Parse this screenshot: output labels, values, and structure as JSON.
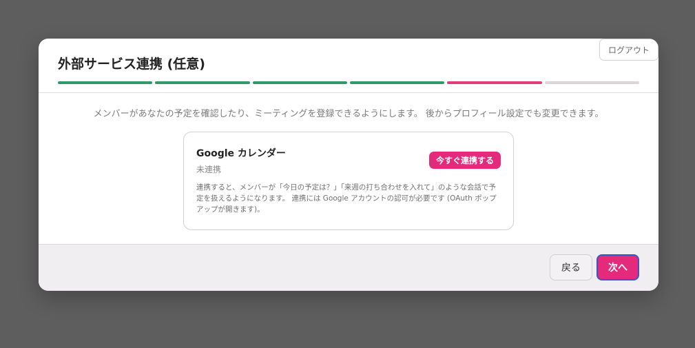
{
  "header": {
    "title": "外部サービス連携 (任意)",
    "logout_label": "ログアウト"
  },
  "progress": {
    "total_steps": 6,
    "current_step": 5,
    "colors": {
      "done": "#2f9a63",
      "current": "#e03b7a",
      "pending": "#ddd4d8"
    }
  },
  "intro": "メンバーがあなたの予定を確認したり、ミーティングを登録できるようにします。 後からプロフィール設定でも変更できます。",
  "integration": {
    "name": "Google カレンダー",
    "status": "未連携",
    "connect_label": "今すぐ連携する",
    "description": "連携すると、メンバーが「今日の予定は？」「来週の打ち合わせを入れて」のような会話で予定を扱えるようになります。 連携には Google アカウントの認可が必要です (OAuth ポップアップが開きます)。"
  },
  "footer": {
    "back_label": "戻る",
    "next_label": "次へ"
  }
}
